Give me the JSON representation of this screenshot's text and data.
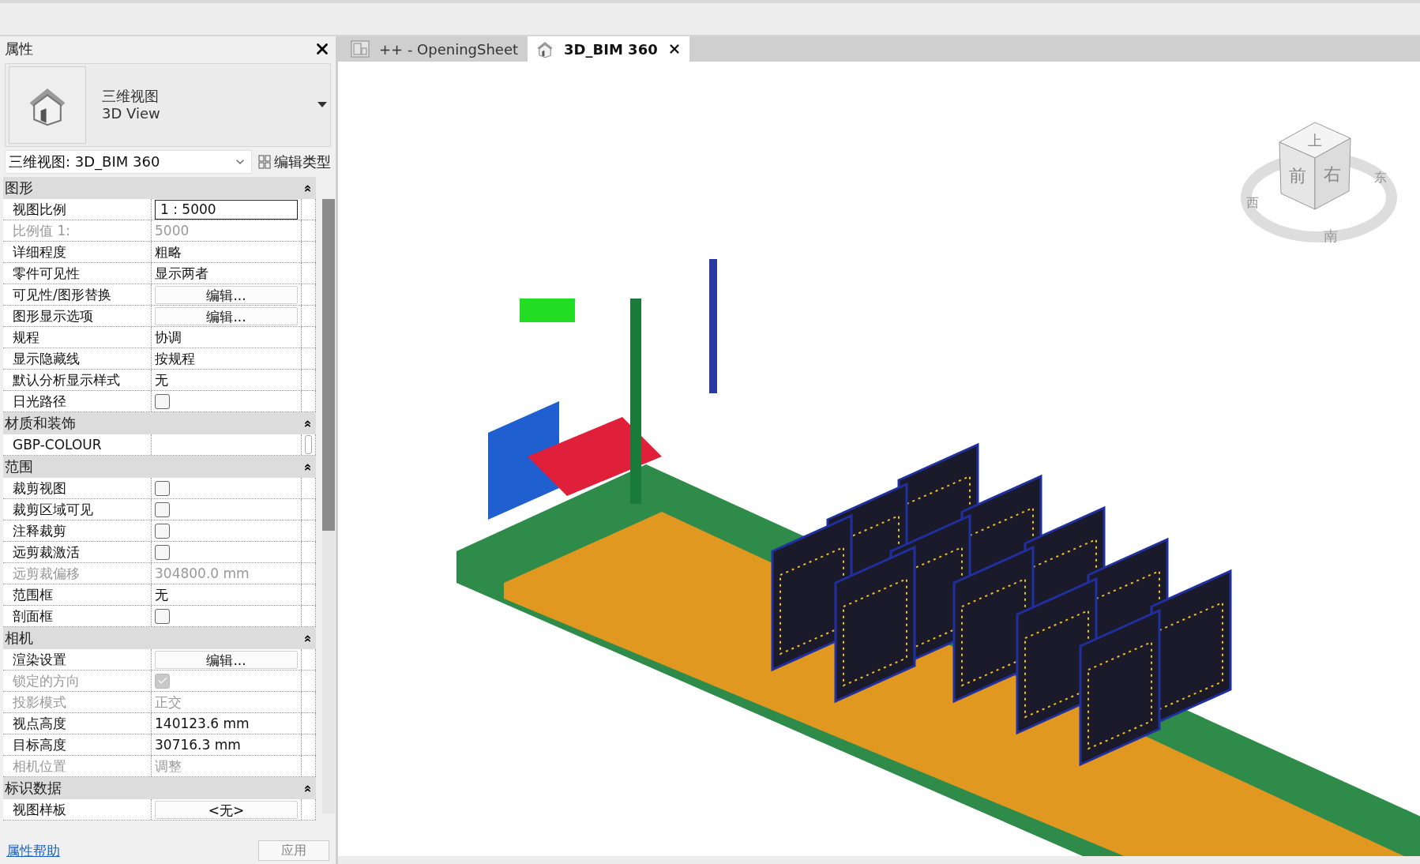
{
  "properties_panel": {
    "title": "属性",
    "type_preview": {
      "category": "三维视图",
      "name": "3D View"
    },
    "type_selector": "三维视图: 3D_BIM 360",
    "edit_type": "编辑类型",
    "sections": [
      {
        "title": "图形",
        "rows": [
          {
            "label": "视图比例",
            "kind": "field",
            "value": "1 : 5000",
            "disabled": false
          },
          {
            "label": "比例值 1:",
            "kind": "text",
            "value": "5000",
            "disabled": true
          },
          {
            "label": "详细程度",
            "kind": "text",
            "value": "粗略",
            "disabled": false
          },
          {
            "label": "零件可见性",
            "kind": "text",
            "value": "显示两者",
            "disabled": false
          },
          {
            "label": "可见性/图形替换",
            "kind": "button",
            "value": "编辑...",
            "disabled": false
          },
          {
            "label": "图形显示选项",
            "kind": "button",
            "value": "编辑...",
            "disabled": false
          },
          {
            "label": "规程",
            "kind": "text",
            "value": "协调",
            "disabled": false
          },
          {
            "label": "显示隐藏线",
            "kind": "text",
            "value": "按规程",
            "disabled": false
          },
          {
            "label": "默认分析显示样式",
            "kind": "text",
            "value": "无",
            "disabled": false
          },
          {
            "label": "日光路径",
            "kind": "checkbox",
            "checked": false,
            "disabled": false
          }
        ]
      },
      {
        "title": "材质和装饰",
        "rows": [
          {
            "label": "GBP-COLOUR",
            "kind": "material",
            "disabled": false
          }
        ]
      },
      {
        "title": "范围",
        "rows": [
          {
            "label": "裁剪视图",
            "kind": "checkbox",
            "checked": false,
            "disabled": false
          },
          {
            "label": "裁剪区域可见",
            "kind": "checkbox",
            "checked": false,
            "disabled": false
          },
          {
            "label": "注释裁剪",
            "kind": "checkbox",
            "checked": false,
            "disabled": false
          },
          {
            "label": "远剪裁激活",
            "kind": "checkbox",
            "checked": false,
            "disabled": false
          },
          {
            "label": "远剪裁偏移",
            "kind": "text",
            "value": "304800.0 mm",
            "disabled": true
          },
          {
            "label": "范围框",
            "kind": "text",
            "value": "无",
            "disabled": false
          },
          {
            "label": "剖面框",
            "kind": "checkbox",
            "checked": false,
            "disabled": false
          }
        ]
      },
      {
        "title": "相机",
        "rows": [
          {
            "label": "渲染设置",
            "kind": "button",
            "value": "编辑...",
            "disabled": false
          },
          {
            "label": "锁定的方向",
            "kind": "checkbox",
            "checked": true,
            "disabled": true
          },
          {
            "label": "投影模式",
            "kind": "text",
            "value": "正交",
            "disabled": true
          },
          {
            "label": "视点高度",
            "kind": "text",
            "value": "140123.6 mm",
            "disabled": false
          },
          {
            "label": "目标高度",
            "kind": "text",
            "value": "30716.3 mm",
            "disabled": false
          },
          {
            "label": "相机位置",
            "kind": "text",
            "value": "调整",
            "disabled": true
          }
        ]
      },
      {
        "title": "标识数据",
        "rows": [
          {
            "label": "视图样板",
            "kind": "button",
            "value": "<无>",
            "disabled": false
          }
        ]
      }
    ],
    "help_link": "属性帮助",
    "apply_button": "应用"
  },
  "tabs": [
    {
      "label": "++ - OpeningSheet",
      "kind": "sheet",
      "selected": false
    },
    {
      "label": "3D_BIM 360",
      "kind": "view3d",
      "selected": true
    }
  ],
  "viewcube": {
    "top": "上",
    "front": "前",
    "right": "右",
    "east": "东",
    "west": "西",
    "south": "南"
  }
}
